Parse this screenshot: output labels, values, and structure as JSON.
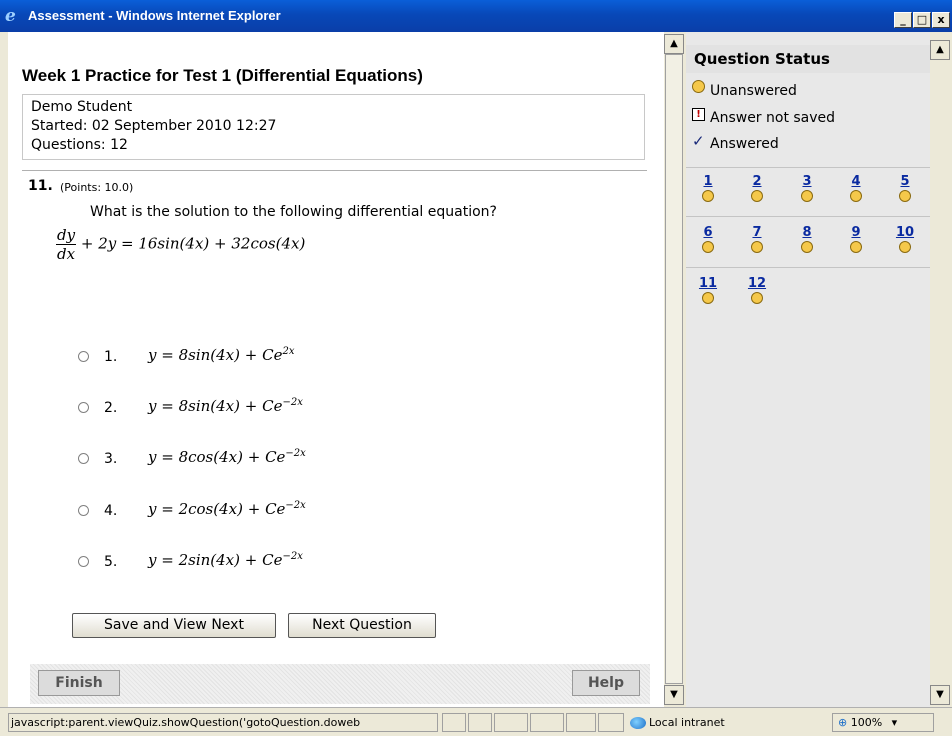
{
  "window": {
    "title": "Assessment - Windows Internet Explorer",
    "minimize": "_",
    "maximize": "□",
    "close": "x"
  },
  "page": {
    "title": "Week 1 Practice for Test 1 (Differential Equations)",
    "student": "Demo Student",
    "started": "Started: 02 September 2010 12:27",
    "questions": "Questions: 12"
  },
  "question": {
    "number": "11.",
    "points": "(Points: 10.0)",
    "text": "What is the solution to the following differential equation?",
    "equation": {
      "numerator": "dy",
      "denominator": "dx",
      "rest": "+ 2y = 16sin(4x) + 32cos(4x)"
    },
    "options": [
      {
        "num": "1.",
        "lhs": "y = 8sin(4x) + Ce",
        "exp": "2x"
      },
      {
        "num": "2.",
        "lhs": "y = 8sin(4x) + Ce",
        "exp": "−2x"
      },
      {
        "num": "3.",
        "lhs": "y = 8cos(4x) + Ce",
        "exp": "−2x"
      },
      {
        "num": "4.",
        "lhs": "y = 2cos(4x) + Ce",
        "exp": "−2x"
      },
      {
        "num": "5.",
        "lhs": "y = 2sin(4x) + Ce",
        "exp": "−2x"
      }
    ]
  },
  "buttons": {
    "save_next": "Save and View Next",
    "next_question": "Next Question",
    "finish": "Finish",
    "help": "Help"
  },
  "status_panel": {
    "header": "Question Status",
    "legend": {
      "unanswered": "Unanswered",
      "not_saved": "Answer not saved",
      "answered": "Answered"
    },
    "not_saved_glyph": "!",
    "answered_glyph": "✓",
    "questions": [
      "1",
      "2",
      "3",
      "4",
      "5",
      "6",
      "7",
      "8",
      "9",
      "10",
      "11",
      "12"
    ]
  },
  "statusbar": {
    "url": "javascript:parent.viewQuiz.showQuestion('gotoQuestion.doweb",
    "zone": "Local intranet",
    "zoom": "100%"
  },
  "icons": {
    "ie": "ie-logo-icon",
    "scroll_up": "▲",
    "scroll_down": "▼"
  },
  "colors": {
    "titlebar": "#0848b8",
    "unanswered": "#f5c84a",
    "link": "#0a2aa0"
  }
}
